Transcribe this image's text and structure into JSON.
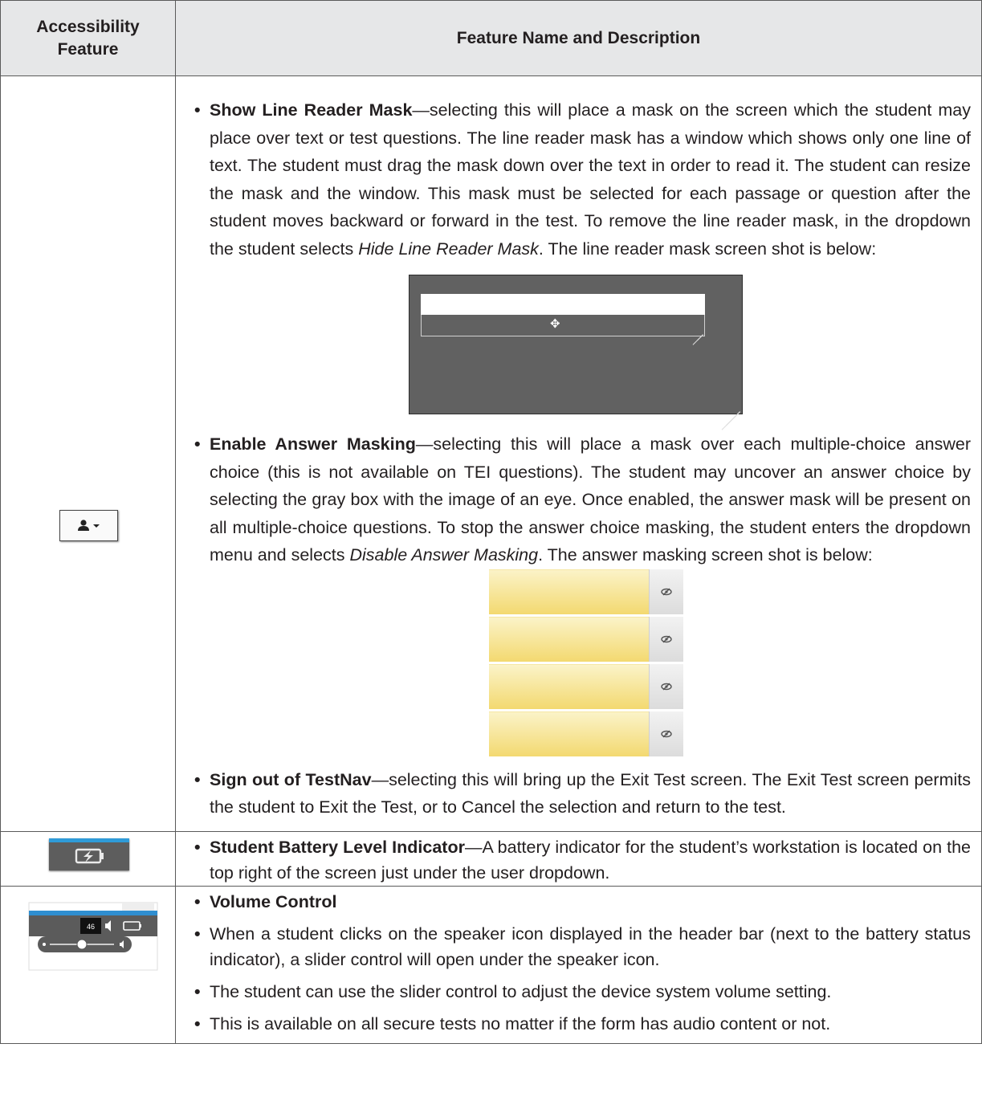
{
  "header": {
    "col1": "Accessibility Feature",
    "col2": "Feature Name and Description"
  },
  "rows": [
    {
      "icon": "user-dropdown-icon",
      "items": [
        {
          "title": "Show Line Reader Mask",
          "text_1": "—selecting this will place a mask on the screen which the student may place over text or test questions. The line reader mask has a window which shows only one line of text. The student must drag the mask down over the text in order to read it. The student can resize the mask and the window. This mask must be selected for each passage or question after the student moves backward or forward in the test. To remove the line reader mask, in the dropdown the student selects ",
          "italic": "Hide Line Reader Mask",
          "text_2": ". The line reader mask screen shot is below:"
        },
        {
          "title": "Enable Answer Masking",
          "text_1": "—selecting this will place a mask over each multiple-choice answer choice (this is not available on TEI questions). The student may uncover an answer choice by selecting the gray box with the image of an eye. Once enabled, the answer mask will be present on all multiple-choice questions. To stop the answer choice masking, the student enters the dropdown menu and selects ",
          "italic": "Disable Answer Masking",
          "text_2": ". The answer masking screen shot is below:"
        },
        {
          "title": "Sign out of TestNav",
          "text_1": "—selecting this will bring up the Exit Test screen. The Exit Test screen permits the student to Exit the Test, or to Cancel the selection and return to the test."
        }
      ]
    },
    {
      "icon": "battery-icon",
      "items": [
        {
          "title": "Student Battery Level Indicator",
          "text_1": "—A battery indicator for the student’s workstation is located on the top right of the screen just under the user dropdown."
        }
      ]
    },
    {
      "icon": "volume-slider-icon",
      "volume_value": "46",
      "items": [
        {
          "title": "Volume Control"
        },
        {
          "text_1": "When a student clicks on the speaker icon displayed in the header bar (next to the battery status indicator), a slider control will open under the speaker icon."
        },
        {
          "text_1": "The student can use the slider control to adjust the device system volume setting."
        },
        {
          "text_1": "This is available on all secure tests no matter if the form has audio content or not."
        }
      ]
    }
  ],
  "colors": {
    "header_bg": "#e6e7e8",
    "mask_gray": "#616161",
    "answer_yellow": "#f3d970",
    "battery_blue": "#2f9bd8"
  }
}
